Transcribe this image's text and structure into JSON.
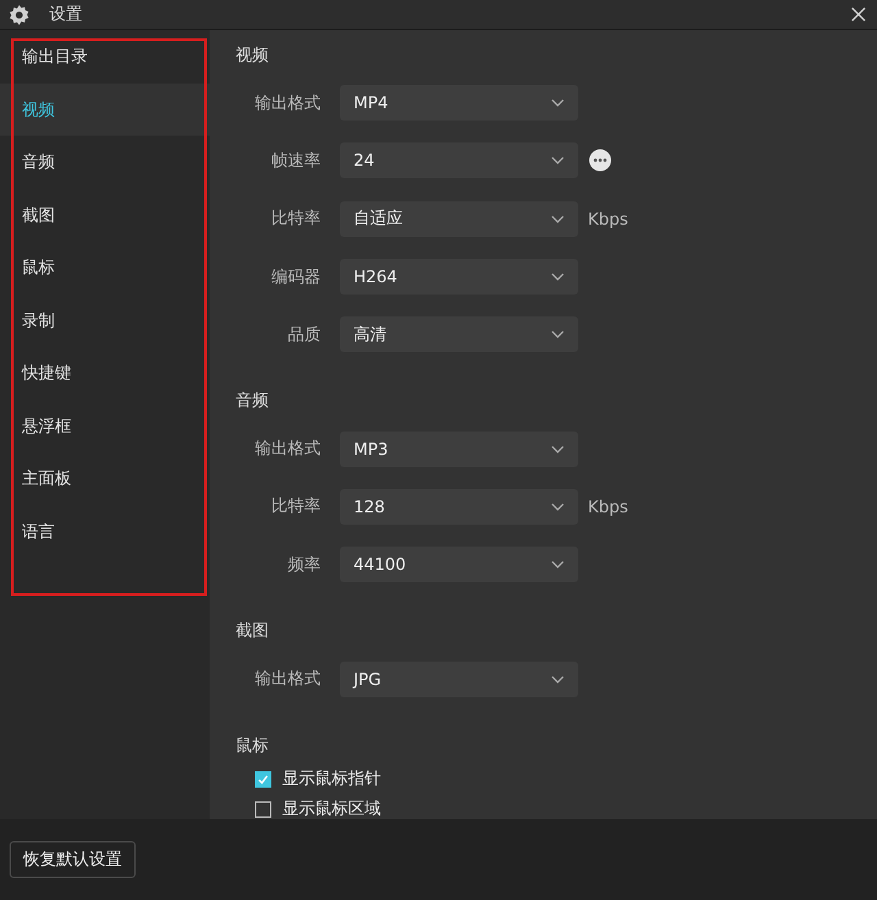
{
  "window": {
    "title": "设置"
  },
  "sidebar": {
    "items": [
      {
        "label": "输出目录",
        "selected": false
      },
      {
        "label": "视频",
        "selected": true
      },
      {
        "label": "音频",
        "selected": false
      },
      {
        "label": "截图",
        "selected": false
      },
      {
        "label": "鼠标",
        "selected": false
      },
      {
        "label": "录制",
        "selected": false
      },
      {
        "label": "快捷键",
        "selected": false
      },
      {
        "label": "悬浮框",
        "selected": false
      },
      {
        "label": "主面板",
        "selected": false
      },
      {
        "label": "语言",
        "selected": false
      }
    ]
  },
  "sections": [
    {
      "title": "视频",
      "rows": [
        {
          "kind": "select",
          "label": "输出格式",
          "value": "MP4"
        },
        {
          "kind": "select",
          "label": "帧速率",
          "value": "24",
          "more": true
        },
        {
          "kind": "select",
          "label": "比特率",
          "value": "自适应",
          "unit": "Kbps"
        },
        {
          "kind": "select",
          "label": "编码器",
          "value": "H264"
        },
        {
          "kind": "select",
          "label": "品质",
          "value": "高清"
        }
      ]
    },
    {
      "title": "音频",
      "rows": [
        {
          "kind": "select",
          "label": "输出格式",
          "value": "MP3"
        },
        {
          "kind": "select",
          "label": "比特率",
          "value": "128",
          "unit": "Kbps"
        },
        {
          "kind": "select",
          "label": "频率",
          "value": "44100"
        }
      ]
    },
    {
      "title": "截图",
      "rows": [
        {
          "kind": "select",
          "label": "输出格式",
          "value": "JPG"
        }
      ]
    },
    {
      "title": "鼠标",
      "rows": [
        {
          "kind": "checkbox",
          "label": "显示鼠标指针",
          "checked": true
        },
        {
          "kind": "checkbox",
          "label": "显示鼠标区域",
          "checked": false
        }
      ]
    }
  ],
  "footer": {
    "button": "恢复默认设置"
  }
}
